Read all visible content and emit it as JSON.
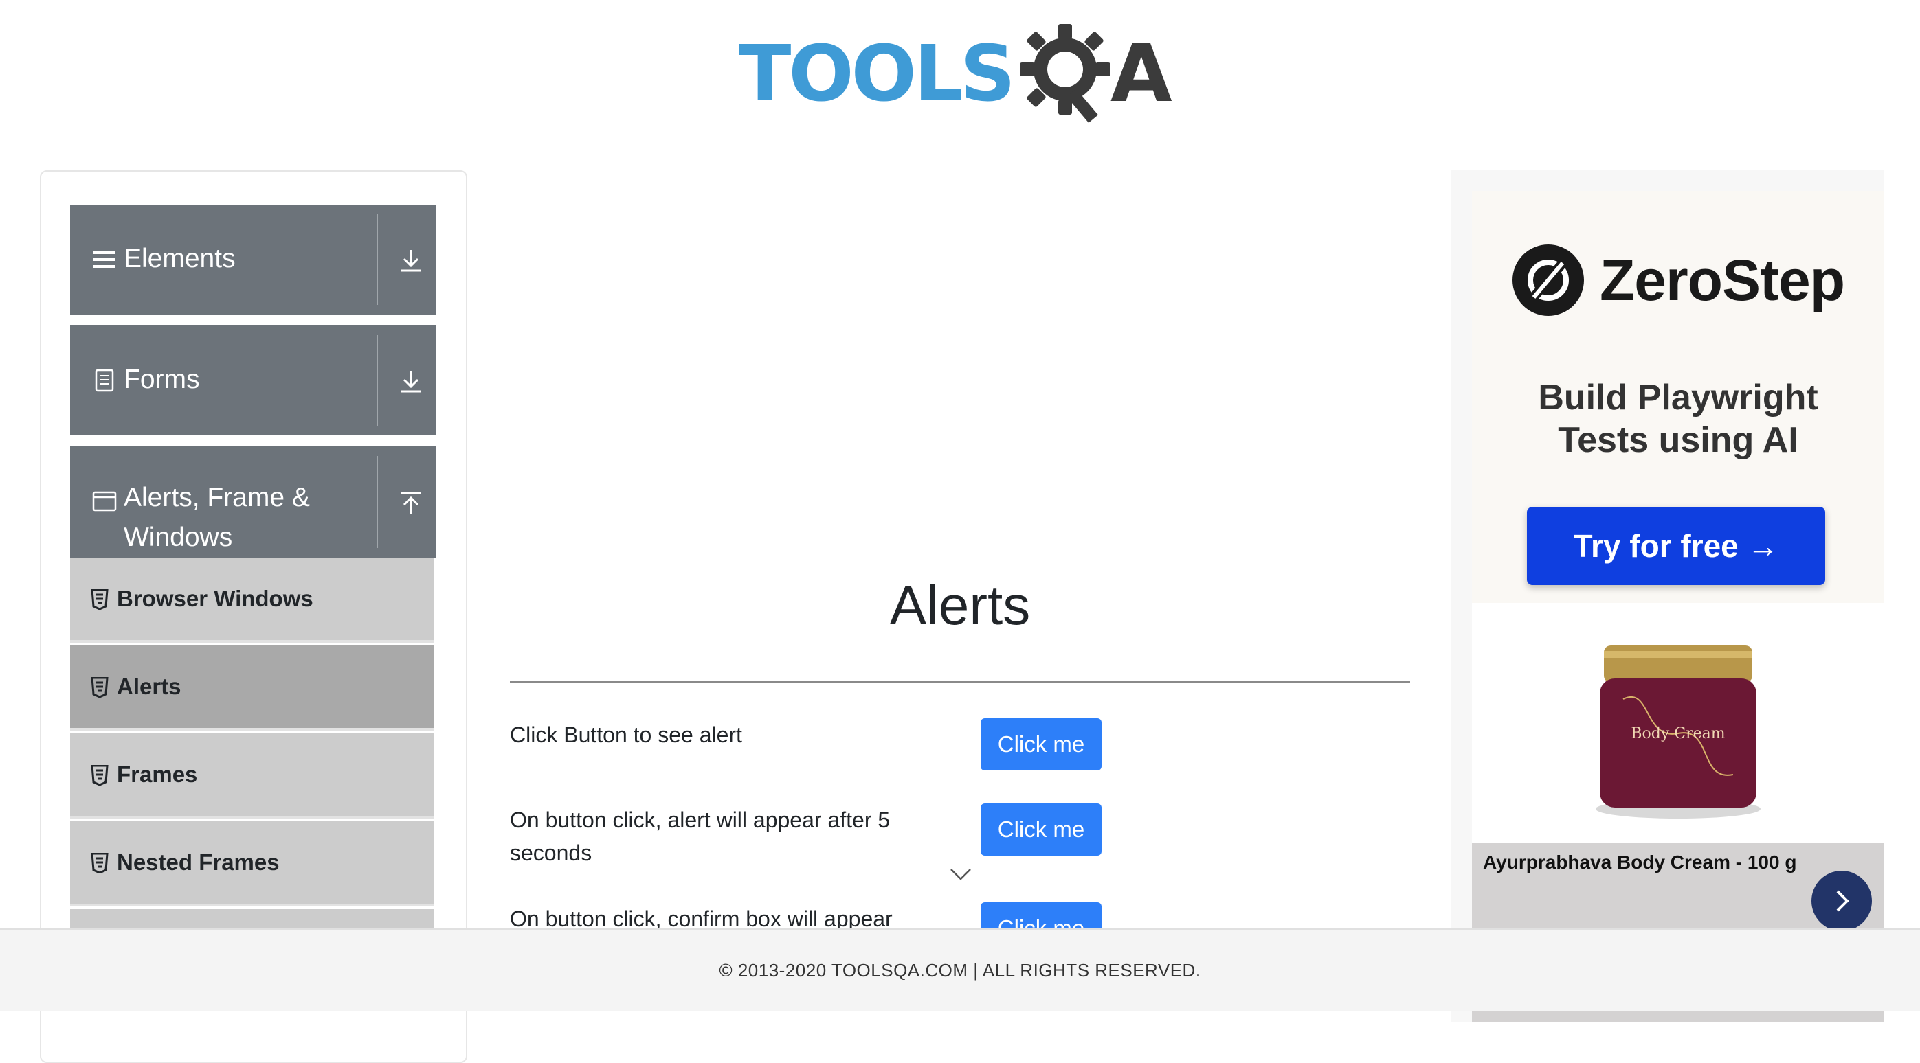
{
  "header": {
    "logo_text_primary": "TOOLS",
    "logo_text_secondary": "A"
  },
  "sidebar": {
    "groups": [
      {
        "label": "Elements",
        "icon": "hamburger-icon",
        "toggle_icon": "expand-down-icon"
      },
      {
        "label": "Forms",
        "icon": "document-icon",
        "toggle_icon": "expand-down-icon"
      },
      {
        "label_line1": "Alerts, Frame &",
        "label_line2": "Windows",
        "icon": "window-icon",
        "toggle_icon": "collapse-up-icon"
      }
    ],
    "items": [
      {
        "label": "Browser Windows",
        "active": false
      },
      {
        "label": "Alerts",
        "active": true
      },
      {
        "label": "Frames",
        "active": false
      },
      {
        "label": "Nested Frames",
        "active": false
      }
    ]
  },
  "main": {
    "title": "Alerts",
    "rows": [
      {
        "text": "Click Button to see alert",
        "button": "Click me"
      },
      {
        "text": "On button click, alert will appear after 5 seconds",
        "button": "Click me"
      },
      {
        "text": "On button click, confirm box will appear",
        "button": "Click me"
      }
    ]
  },
  "ad": {
    "brand": "ZeroStep",
    "tagline_line1": "Build Playwright",
    "tagline_line2": "Tests using AI",
    "cta": "Try for free →",
    "product_name": "Ayurprabhava Body Cream - 100 g",
    "product_jar_label": "Body Cream"
  },
  "footer": {
    "copyright": "© 2013-2020 TOOLSQA.COM | ALL RIGHTS RESERVED."
  },
  "colors": {
    "logo_blue": "#3f9bd6",
    "logo_dark": "#3b3b3b",
    "sidebar_header": "#6c737a",
    "sidebar_item": "#cccccc",
    "sidebar_item_active": "#a9a9a9",
    "button_blue": "#2d7ff9",
    "ad_cta": "#0f3fe0"
  }
}
